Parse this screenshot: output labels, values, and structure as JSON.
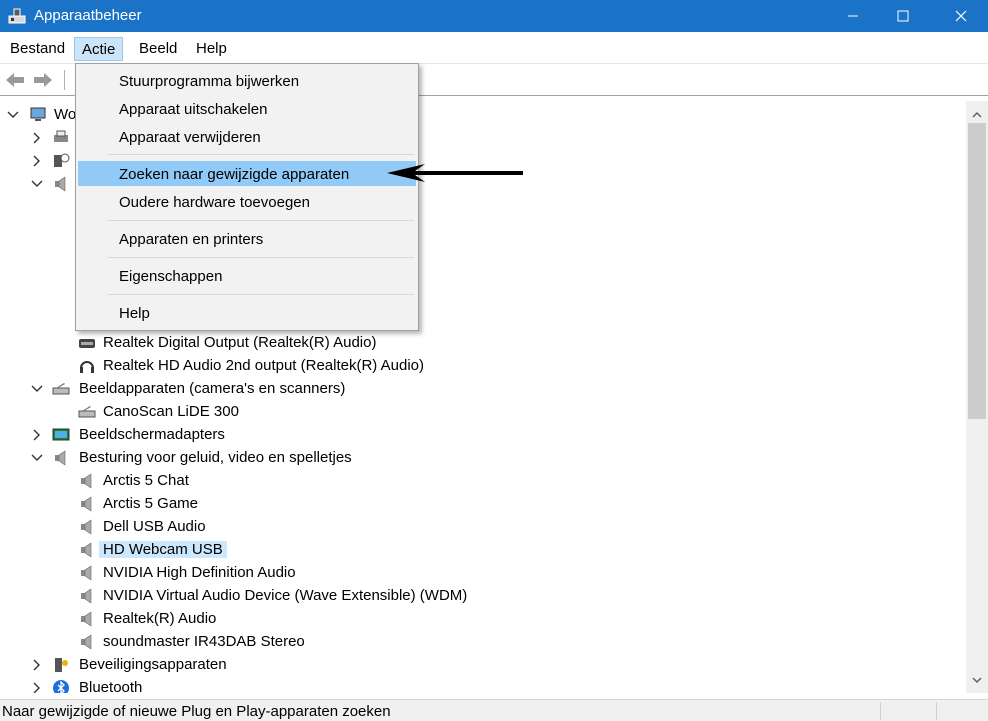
{
  "window": {
    "title": "Apparaatbeheer",
    "controls": [
      "minimize",
      "maximize",
      "close"
    ]
  },
  "menubar": {
    "items": [
      {
        "label": "Bestand"
      },
      {
        "label": "Actie",
        "active": true
      },
      {
        "label": "Beeld"
      },
      {
        "label": "Help"
      }
    ]
  },
  "action_menu": {
    "items": [
      {
        "label": "Stuurprogramma bijwerken"
      },
      {
        "label": "Apparaat uitschakelen"
      },
      {
        "label": "Apparaat verwijderen"
      },
      {
        "label": "Zoeken naar gewijzigde apparaten",
        "highlighted": true
      },
      {
        "label": "Oudere hardware toevoegen"
      },
      {
        "label": "Apparaten en printers"
      },
      {
        "label": "Eigenschappen"
      },
      {
        "label": "Help"
      }
    ]
  },
  "tree": {
    "root_label": "Wo",
    "rows": [
      {
        "label": "Realtek Digital Output (Realtek(R) Audio)",
        "icon": "speaker-output-icon"
      },
      {
        "label": "Realtek HD Audio 2nd output (Realtek(R) Audio)",
        "icon": "headphones-icon"
      },
      {
        "label": "Beeldapparaten (camera's en scanners)",
        "icon": "camera-scanner-icon",
        "expanded": true
      },
      {
        "label": "CanoScan LiDE 300",
        "icon": "scanner-icon"
      },
      {
        "label": "Beeldschermadapters",
        "icon": "display-adapter-icon",
        "expanded": false
      },
      {
        "label": "Besturing voor geluid, video en spelletjes",
        "icon": "speaker-icon",
        "expanded": true
      },
      {
        "label": "Arctis 5 Chat",
        "icon": "speaker-icon"
      },
      {
        "label": "Arctis 5 Game",
        "icon": "speaker-icon"
      },
      {
        "label": "Dell USB Audio",
        "icon": "speaker-icon"
      },
      {
        "label": "HD Webcam USB",
        "icon": "speaker-icon",
        "selected": true
      },
      {
        "label": "NVIDIA High Definition Audio",
        "icon": "speaker-icon"
      },
      {
        "label": "NVIDIA Virtual Audio Device (Wave Extensible) (WDM)",
        "icon": "speaker-icon"
      },
      {
        "label": "Realtek(R) Audio",
        "icon": "speaker-icon"
      },
      {
        "label": "soundmaster IR43DAB Stereo",
        "icon": "speaker-icon"
      },
      {
        "label": "Beveiligingsapparaten",
        "icon": "security-key-icon",
        "expanded": false
      },
      {
        "label": "Bluetooth",
        "icon": "bluetooth-icon",
        "expanded": false
      }
    ]
  },
  "statusbar": {
    "message": "Naar gewijzigde of nieuwe Plug en Play-apparaten zoeken"
  },
  "colors": {
    "titlebar": "#1a73c7",
    "menu_highlight": "#91c9f7",
    "selection": "#cce8ff"
  }
}
